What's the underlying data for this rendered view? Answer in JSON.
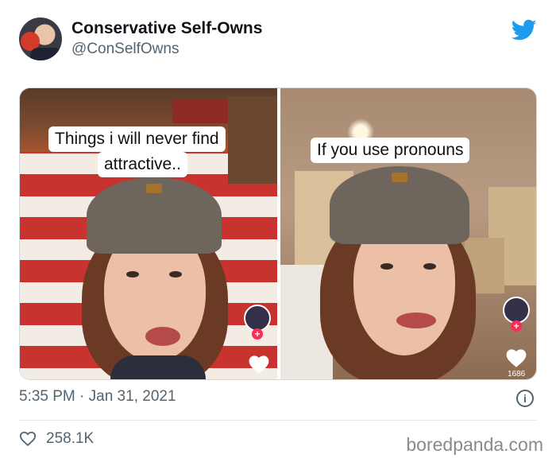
{
  "tweet": {
    "author_name": "Conservative Self-Owns",
    "author_handle": "@ConSelfOwns",
    "timestamp": "5:35 PM · Jan 31, 2021",
    "likes": "258.1K"
  },
  "media": {
    "left": {
      "caption_line1": "Things i will never find",
      "caption_line2": "attractive.."
    },
    "right": {
      "caption": "If you use pronouns",
      "like_count": "1686"
    }
  },
  "watermark": "boredpanda.com",
  "icons": {
    "brand": "twitter-bird-icon",
    "info": "info-icon",
    "like": "heart-outline-icon"
  },
  "colors": {
    "twitter_blue": "#1d9bf0",
    "secondary_text": "#536471",
    "tiktok_pink": "#fe2c55"
  }
}
